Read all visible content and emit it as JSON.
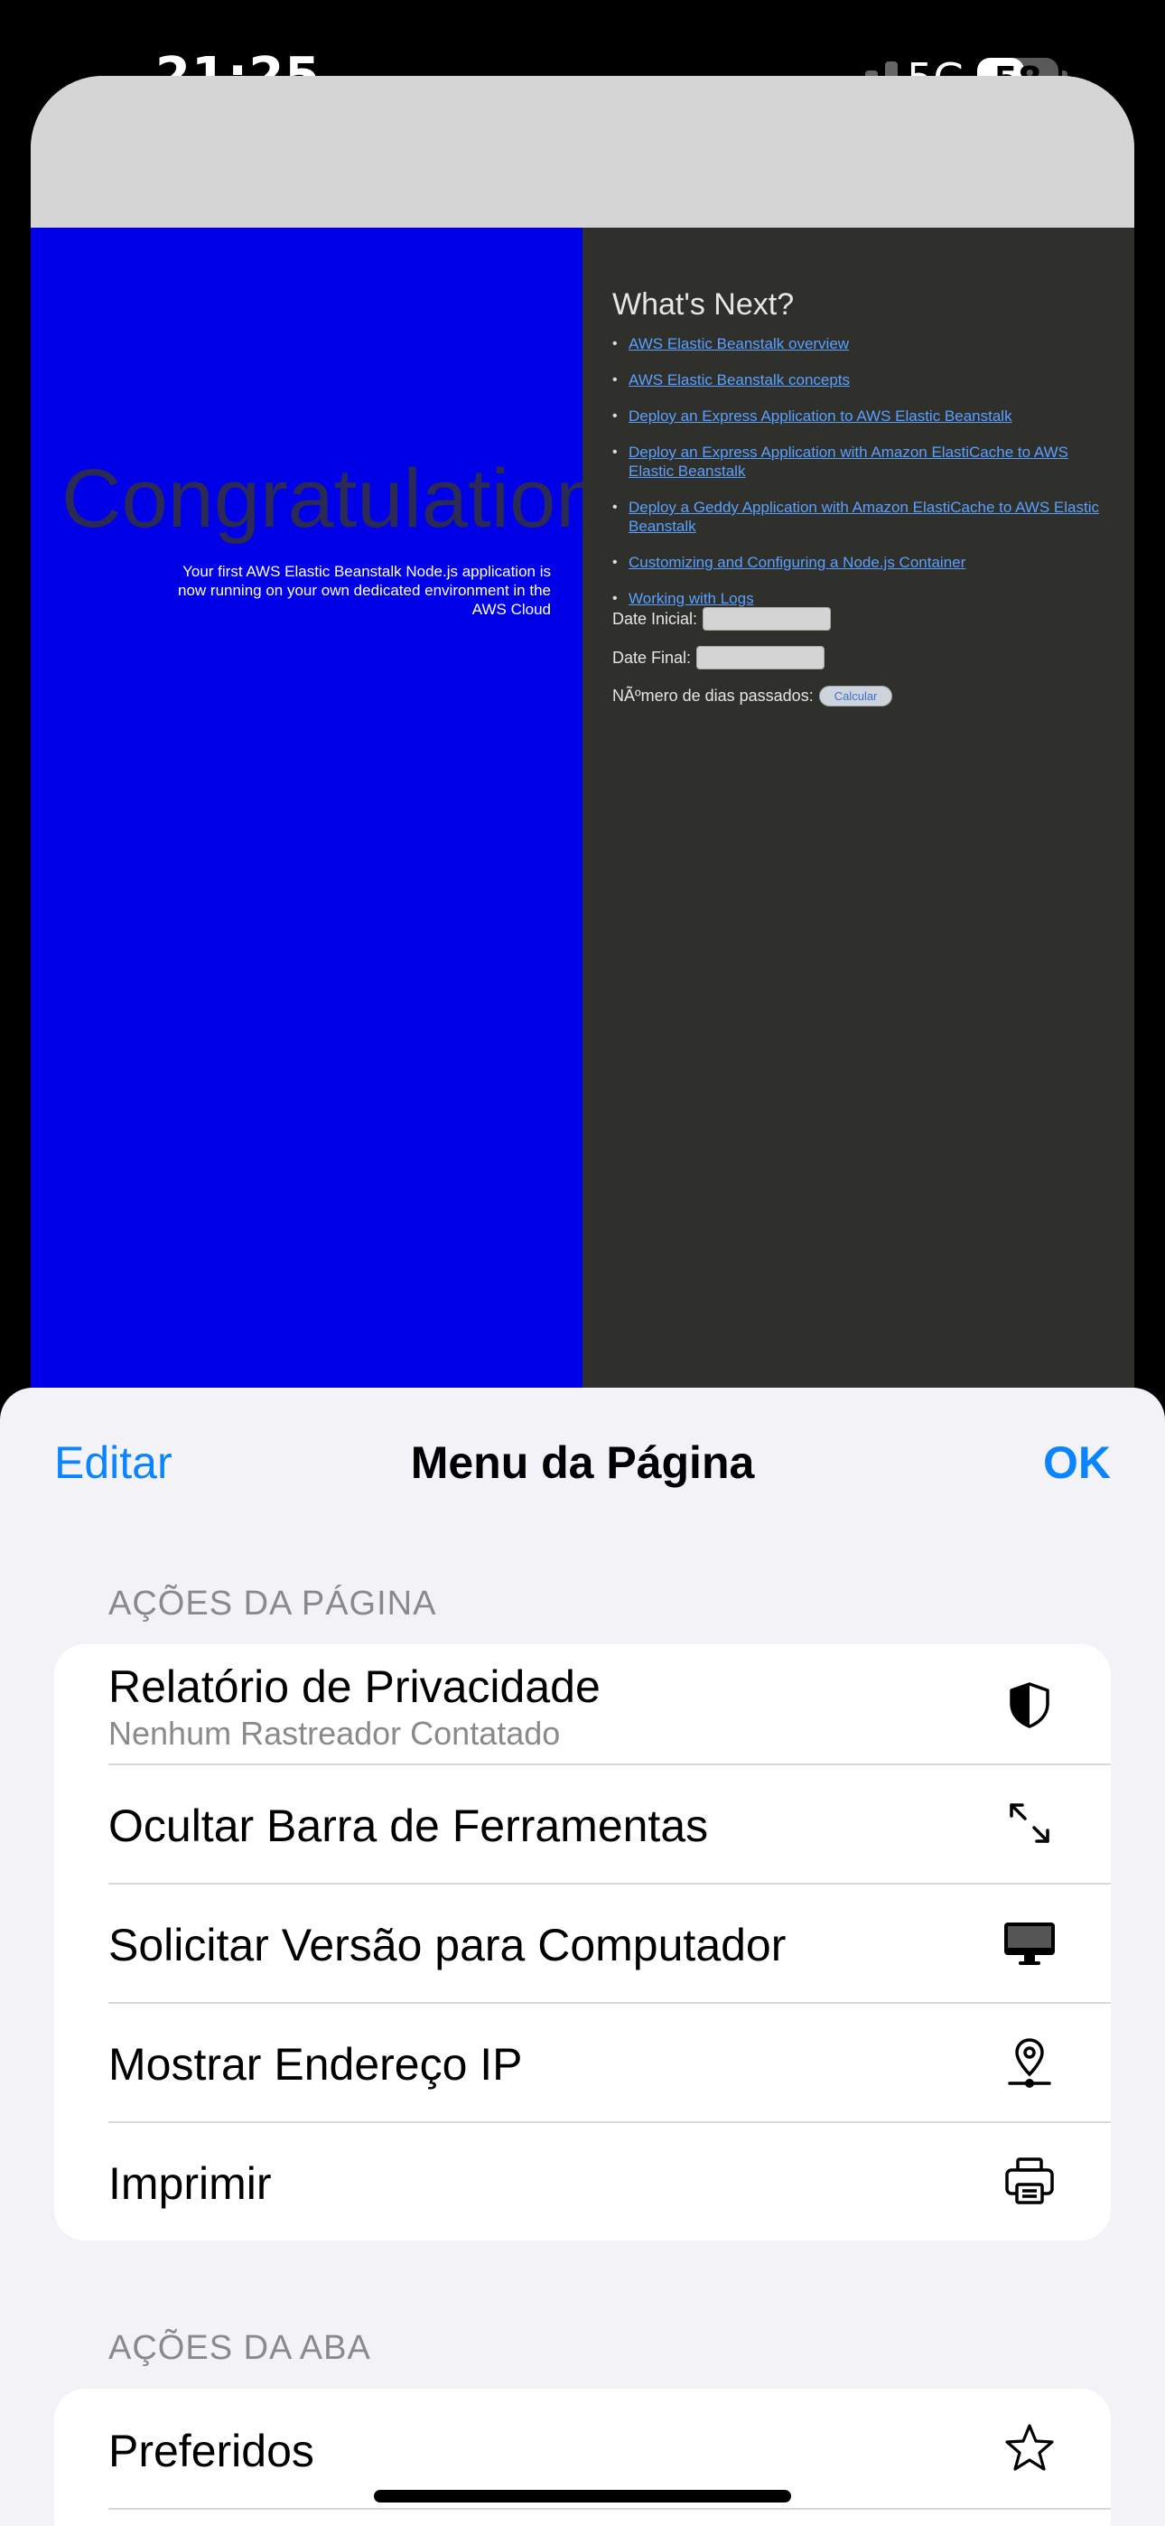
{
  "status_bar": {
    "time": "21:25",
    "network": "5G",
    "battery": "58",
    "battery_level": 0.58
  },
  "web_page": {
    "congrats": "Congratulations",
    "app_message": "Your first AWS Elastic Beanstalk Node.js application is now running on your own dedicated environment in the AWS Cloud",
    "next_title": "What's Next?",
    "links": [
      "AWS Elastic Beanstalk overview",
      "AWS Elastic Beanstalk concepts",
      "Deploy an Express Application to AWS Elastic Beanstalk",
      "Deploy an Express Application with Amazon ElastiCache to AWS Elastic Beanstalk",
      "Deploy a Geddy Application with Amazon ElastiCache to AWS Elastic Beanstalk",
      "Customizing and Configuring a Node.js Container",
      "Working with Logs"
    ],
    "date_initial_label": "Date Inicial:",
    "date_final_label": "Date Final:",
    "days_label": "NÃºmero de dias passados:",
    "calc_button": "Calcular"
  },
  "sheet": {
    "edit": "Editar",
    "title": "Menu da Página",
    "ok": "OK",
    "page_actions_header": "AÇÕES DA PÁGINA",
    "page_actions": [
      {
        "label": "Relatório de Privacidade",
        "sublabel": "Nenhum Rastreador Contatado",
        "icon": "shield-icon"
      },
      {
        "label": "Ocultar Barra de Ferramentas",
        "icon": "expand-arrows-icon"
      },
      {
        "label": "Solicitar Versão para Computador",
        "icon": "desktop-icon"
      },
      {
        "label": "Mostrar Endereço IP",
        "icon": "location-pin-icon"
      },
      {
        "label": "Imprimir",
        "icon": "printer-icon"
      }
    ],
    "tab_actions_header": "AÇÕES DA ABA",
    "tab_actions": [
      {
        "label": "Preferidos",
        "icon": "star-icon"
      }
    ]
  }
}
